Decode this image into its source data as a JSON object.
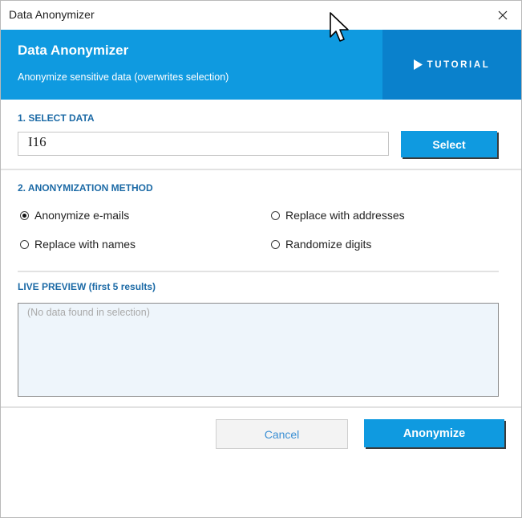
{
  "window": {
    "title": "Data Anonymizer"
  },
  "header": {
    "title": "Data Anonymizer",
    "subtitle": "Anonymize sensitive data  (overwrites selection)",
    "tutorial_label": "TUTORIAL",
    "tutorial_icon": "play-icon"
  },
  "select_data": {
    "label": "1. SELECT DATA",
    "input_value": "I16",
    "button_label": "Select"
  },
  "method": {
    "label": "2. ANONYMIZATION METHOD",
    "options": [
      {
        "label": "Anonymize e-mails",
        "selected": true
      },
      {
        "label": "Replace with addresses",
        "selected": false
      },
      {
        "label": "Replace with names",
        "selected": false
      },
      {
        "label": "Randomize digits",
        "selected": false
      }
    ]
  },
  "preview": {
    "label": "LIVE PREVIEW  (first 5 results)",
    "placeholder": "(No data found in selection)"
  },
  "footer": {
    "cancel_label": "Cancel",
    "anonymize_label": "Anonymize"
  },
  "colors": {
    "accent": "#0f9ae0",
    "accent_dark": "#0a81cc",
    "section_label": "#1c6aa6",
    "preview_bg": "#eef5fb"
  }
}
